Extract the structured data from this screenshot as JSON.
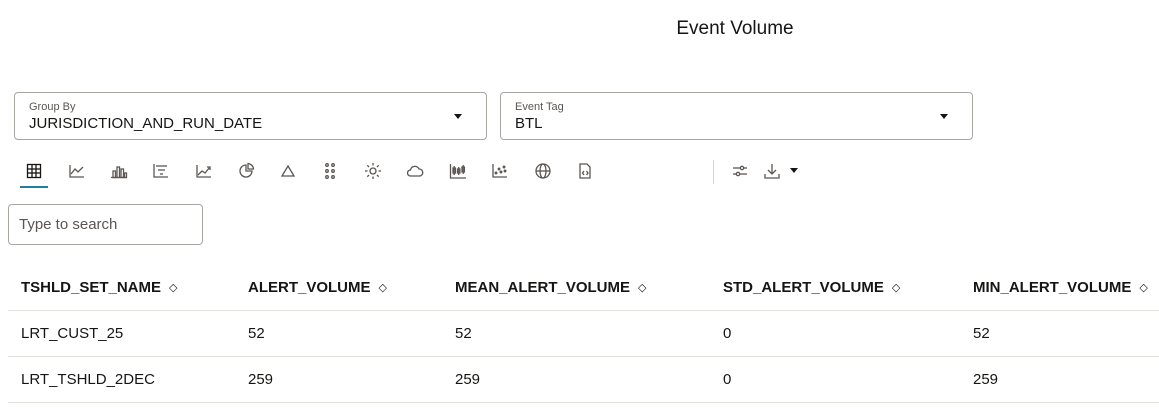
{
  "page": {
    "title": "Event Volume"
  },
  "filters": {
    "group_by": {
      "label": "Group By",
      "value": "JURISDICTION_AND_RUN_DATE"
    },
    "event_tag": {
      "label": "Event Tag",
      "value": "BTL"
    }
  },
  "toolbar": {
    "icons": [
      "table-icon",
      "line-chart-icon",
      "bar-chart-icon",
      "funnel-chart-icon",
      "area-chart-icon",
      "pie-chart-icon",
      "pyramid-icon",
      "dots-grid-icon",
      "sunburst-icon",
      "cloud-icon",
      "box-plot-icon",
      "scatter-chart-icon",
      "globe-icon",
      "code-file-icon",
      "sliders-icon",
      "download-icon"
    ],
    "active": "table-icon"
  },
  "search": {
    "placeholder": "Type to search"
  },
  "table": {
    "columns": [
      "TSHLD_SET_NAME",
      "ALERT_VOLUME",
      "MEAN_ALERT_VOLUME",
      "STD_ALERT_VOLUME",
      "MIN_ALERT_VOLUME"
    ],
    "sort_glyph": "◇",
    "rows": [
      [
        "LRT_CUST_25",
        "52",
        "52",
        "0",
        "52"
      ],
      [
        "LRT_TSHLD_2DEC",
        "259",
        "259",
        "0",
        "259"
      ]
    ]
  }
}
